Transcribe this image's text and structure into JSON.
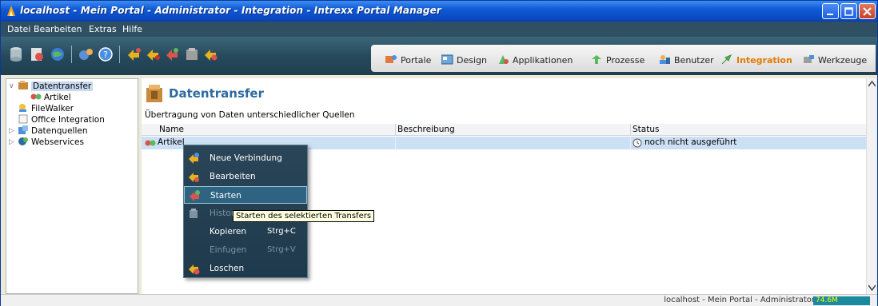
{
  "window": {
    "title": "localhost - Mein Portal - Administrator - Integration - Intrexx Portal Manager"
  },
  "menubar": {
    "items": [
      "Datei",
      "Bearbeiten",
      "Extras",
      "Hilfe"
    ]
  },
  "navbar": {
    "items": [
      {
        "label": "Portale",
        "icon": "portal-icon"
      },
      {
        "label": "Design",
        "icon": "design-icon"
      },
      {
        "label": "Applikationen",
        "icon": "applications-icon"
      },
      {
        "label": "Prozesse",
        "icon": "process-icon"
      },
      {
        "label": "Benutzer",
        "icon": "users-icon"
      },
      {
        "label": "Integration",
        "icon": "integration-icon",
        "active": true
      },
      {
        "label": "Werkzeuge",
        "icon": "tools-icon"
      }
    ]
  },
  "tree": {
    "items": [
      {
        "label": "Datentransfer",
        "selected": true
      },
      {
        "label": "Artikel"
      },
      {
        "label": "FileWalker"
      },
      {
        "label": "Office Integration"
      },
      {
        "label": "Datenquellen"
      },
      {
        "label": "Webservices"
      }
    ]
  },
  "main": {
    "heading": "Datentransfer",
    "subheading": "Übertragung von Daten unterschiedlicher Quellen",
    "columns": [
      "Name",
      "Beschreibung",
      "Status"
    ],
    "rows": [
      {
        "name": "Artikel",
        "description": "",
        "status": "noch nicht ausgeführt"
      }
    ]
  },
  "context_menu": {
    "items": [
      {
        "label": "Neue Verbindung",
        "shortcut": "",
        "disabled": false
      },
      {
        "label": "Bearbeiten",
        "shortcut": "",
        "disabled": false
      },
      {
        "label": "Starten",
        "shortcut": "",
        "disabled": false,
        "hover": true
      },
      {
        "label": "Histor",
        "shortcut": "",
        "disabled": true
      },
      {
        "label": "Kopieren",
        "shortcut": "Strg+C",
        "disabled": false
      },
      {
        "label": "Einfugen",
        "shortcut": "Strg+V",
        "disabled": true
      },
      {
        "label": "Loschen",
        "shortcut": "",
        "disabled": false
      }
    ]
  },
  "tooltip": {
    "text": "Starten des selektierten Transfers"
  },
  "statusbar": {
    "text": "localhost - Mein Portal - Administrator",
    "memory": "74.6M"
  }
}
